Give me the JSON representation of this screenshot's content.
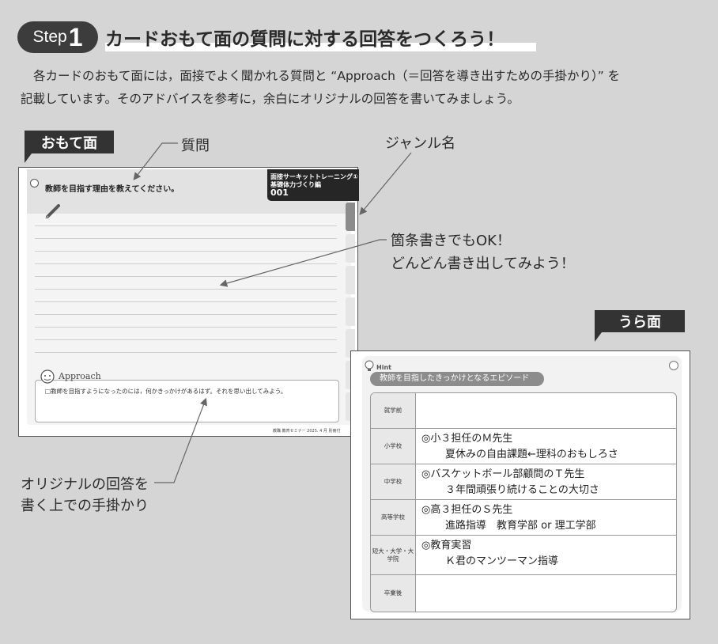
{
  "header": {
    "step_word": "Step",
    "step_number": "1",
    "title": "カードおもて面の質問に対する回答をつくろう！"
  },
  "intro": {
    "line1": "各カードのおもて面には，面接でよく聞かれる質問と “Approach（＝回答を導き出すための手掛かり）” を",
    "line2": "記載しています。そのアドバイスを参考に，余白にオリジナルの回答を書いてみましょう。"
  },
  "labels": {
    "front": "おもて面",
    "back": "うら面"
  },
  "callouts": {
    "question": "質問",
    "genre": "ジャンル名",
    "bullet_line1": "箇条書きでもOK！",
    "bullet_line2": "どんどん書き出してみよう！",
    "hint_line1": "オリジナルの回答を",
    "hint_line2": "書く上での手掛かり"
  },
  "front_card": {
    "question": "教師を目指す理由を教えてください。",
    "genre_line1": "面接サーキットトレーニング①",
    "genre_line2": "基礎体力づくり編",
    "card_number": "001",
    "approach_heading": "Approach",
    "approach_text": "□教師を目指すようになったのには，何かきっかけがあるはず。それを思い出してみよう。",
    "footer": "教職 教育セミナー 2025. 4 月 別冊付"
  },
  "back_card": {
    "hint_badge": "Hint",
    "hint_title": "教師を目指したきっかけとなるエピソード",
    "rows": [
      {
        "stage": "就学前",
        "line1": "",
        "line2": ""
      },
      {
        "stage": "小学校",
        "line1": "◎小３担任のＭ先生",
        "line2": "夏休みの自由課題←理科のおもしろさ"
      },
      {
        "stage": "中学校",
        "line1": "◎バスケットボール部顧問のＴ先生",
        "line2": "３年間頑張り続けることの大切さ"
      },
      {
        "stage": "高等学校",
        "line1": "◎高３担任のＳ先生",
        "line2": "進路指導　教育学部 or 理工学部"
      },
      {
        "stage": "短大・大学・大学院",
        "line1": "◎教育実習",
        "line2": "Ｋ君のマンツーマン指導"
      },
      {
        "stage": "卒業後",
        "line1": "",
        "line2": ""
      }
    ]
  },
  "colors": {
    "background": "#d5d5d5",
    "label_dark": "#333333",
    "accent_gray": "#8c8c8c"
  }
}
